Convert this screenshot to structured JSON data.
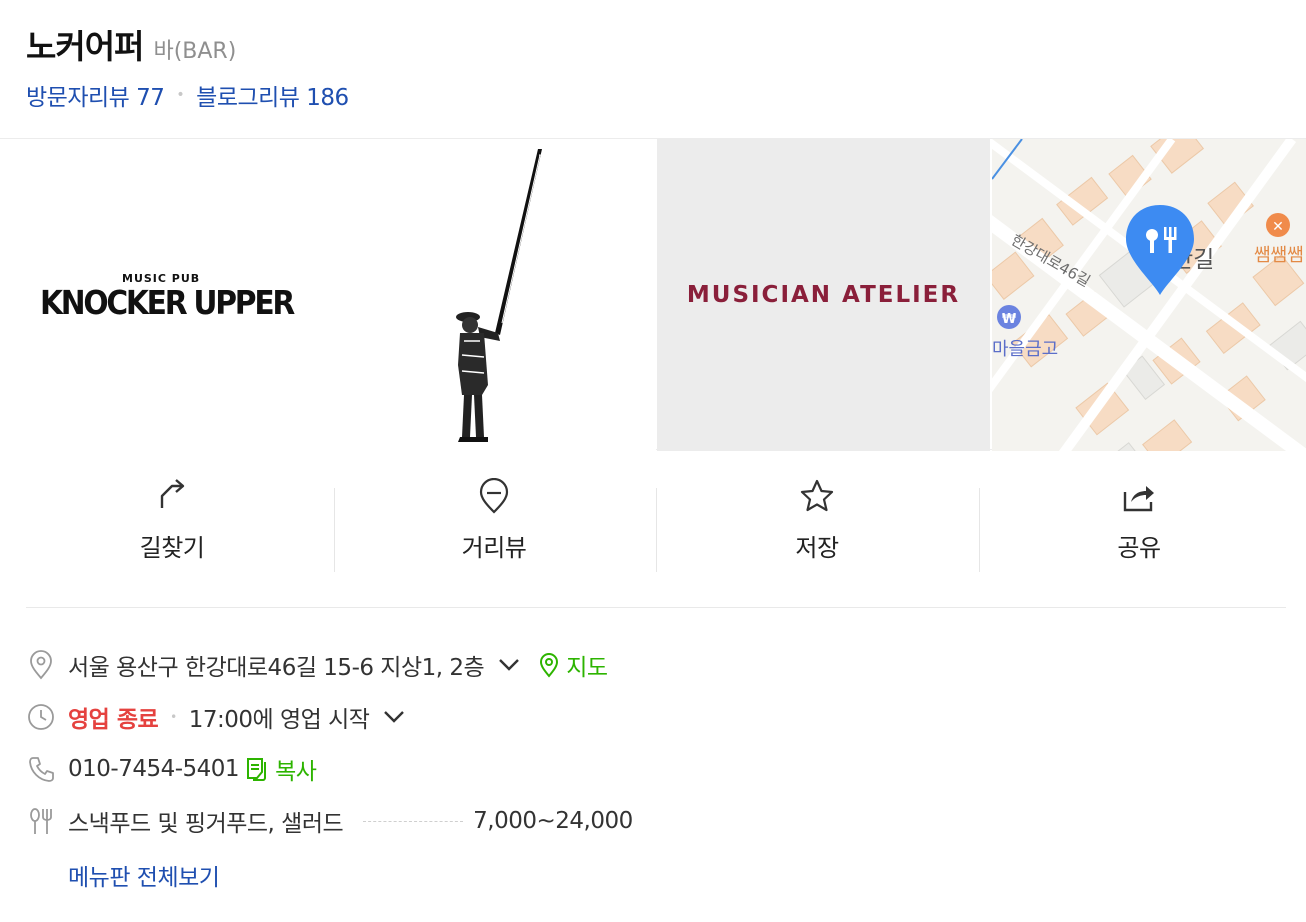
{
  "place": {
    "name": "노커어퍼",
    "category": "바(BAR)"
  },
  "reviews": {
    "visitor_label": "방문자리뷰 77",
    "blog_label": "블로그리뷰 186",
    "separator": "•"
  },
  "photos": {
    "logo_small": "MUSIC PUB",
    "logo_big": "KNOCKER UPPER",
    "atelier_text": "MUSICIAN ATELIER"
  },
  "map": {
    "road_label": "한강대로46길",
    "place_label_partial": "간길",
    "nearby_restaurant": "쌤쌤쌤",
    "bank_label": "마을금고",
    "bank_icon": "₩"
  },
  "actions": [
    {
      "label": "길찾기",
      "icon": "directions-icon"
    },
    {
      "label": "거리뷰",
      "icon": "street-view-icon"
    },
    {
      "label": "저장",
      "icon": "star-icon"
    },
    {
      "label": "공유",
      "icon": "share-icon"
    }
  ],
  "info": {
    "address": "서울 용산구 한강대로46길 15-6 지상1, 2층",
    "map_link": "지도",
    "status": "영업 종료",
    "hours": "17:00에 영업 시작",
    "phone": "010-7454-5401",
    "copy": "복사",
    "menu_name": "스낵푸드 및 핑거푸드, 샐러드",
    "menu_price": "7,000~24,000",
    "menu_link": "메뉴판 전체보기"
  },
  "colors": {
    "link_blue": "#1f4fb0",
    "green": "#2db400",
    "closed_red": "#e5423f",
    "map_pin": "#3d8bf2"
  }
}
